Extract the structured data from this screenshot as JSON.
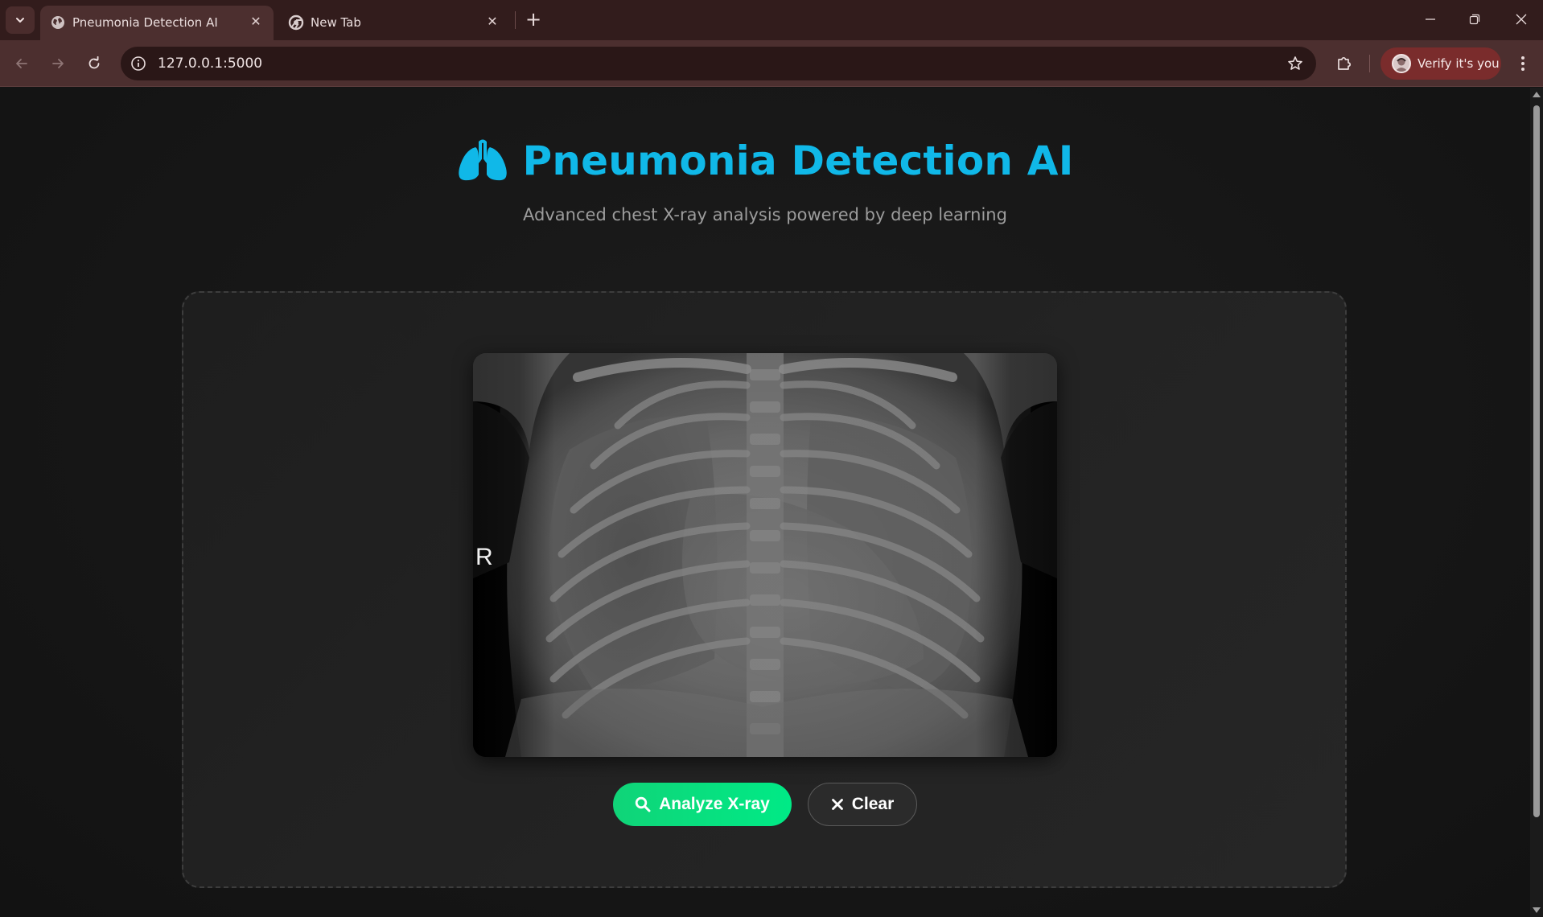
{
  "browser": {
    "tabs": [
      {
        "title": "Pneumonia Detection AI",
        "active": true,
        "favicon": "globe-icon"
      },
      {
        "title": "New Tab",
        "active": false,
        "favicon": "chrome-icon"
      }
    ],
    "new_tab_symbol": "+",
    "close_symbol": "✕",
    "address_bar": {
      "url": "127.0.0.1:5000"
    },
    "profile_button": {
      "label": "Verify it's you"
    }
  },
  "page": {
    "title": "Pneumonia Detection AI",
    "subtitle": "Advanced chest X-ray analysis powered by deep learning",
    "title_icon": "lungs-icon",
    "accent_color": "#10b8e8",
    "preview": {
      "marker_label": "R"
    },
    "buttons": {
      "analyze": {
        "label": "Analyze X-ray",
        "icon": "search-icon",
        "color": "#00e283"
      },
      "clear": {
        "label": "Clear",
        "icon": "close-icon"
      }
    }
  }
}
